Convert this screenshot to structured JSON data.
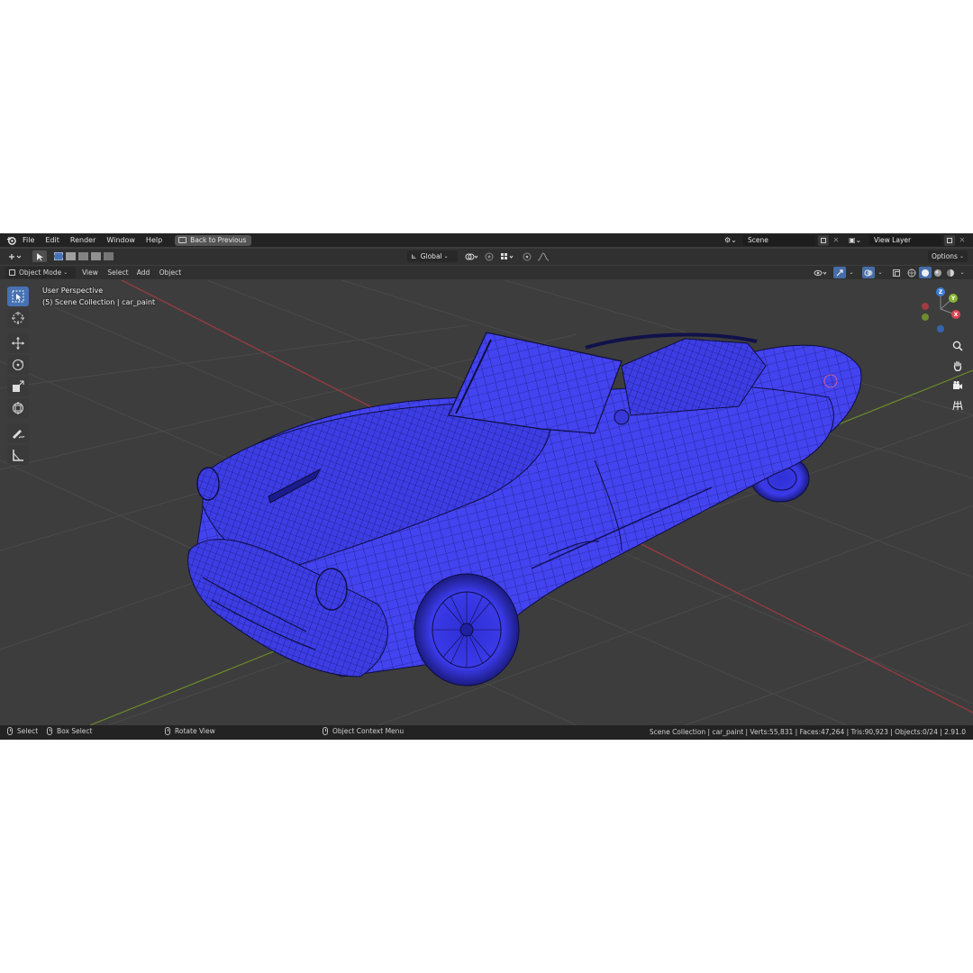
{
  "menu": {
    "items": [
      "File",
      "Edit",
      "Render",
      "Window",
      "Help"
    ],
    "back_button": "Back to Previous"
  },
  "scene": {
    "label": "Scene",
    "layer": "View Layer"
  },
  "tool_header": {
    "orientation": "Global",
    "options": "Options"
  },
  "view_header": {
    "mode": "Object Mode",
    "menus": [
      "View",
      "Select",
      "Add",
      "Object"
    ]
  },
  "viewport": {
    "perspective": "User Perspective",
    "collection": "(5) Scene Collection | car_paint"
  },
  "gizmo": {
    "z": "Z",
    "y": "Y",
    "x": "X"
  },
  "icons": [
    "blender-logo-icon",
    "select-box-icon",
    "cursor-icon",
    "move-icon",
    "rotate-icon",
    "scale-icon",
    "transform-icon",
    "annotate-icon",
    "measure-icon",
    "zoom-icon",
    "pan-hand-icon",
    "camera-icon",
    "grid-icon"
  ],
  "status": {
    "select": "Select",
    "box_select": "Box Select",
    "rotate": "Rotate View",
    "context": "Object Context Menu",
    "stats": "Scene Collection | car_paint | Verts:55,831 | Faces:47,264 | Tris:90,923 | Objects:0/24 | 2.91.0"
  },
  "colors": {
    "mesh": "#4242ee",
    "accent": "#4772b3",
    "x_axis": "#d94452",
    "y_axis": "#8ab632",
    "z_axis": "#3d7ed9"
  }
}
